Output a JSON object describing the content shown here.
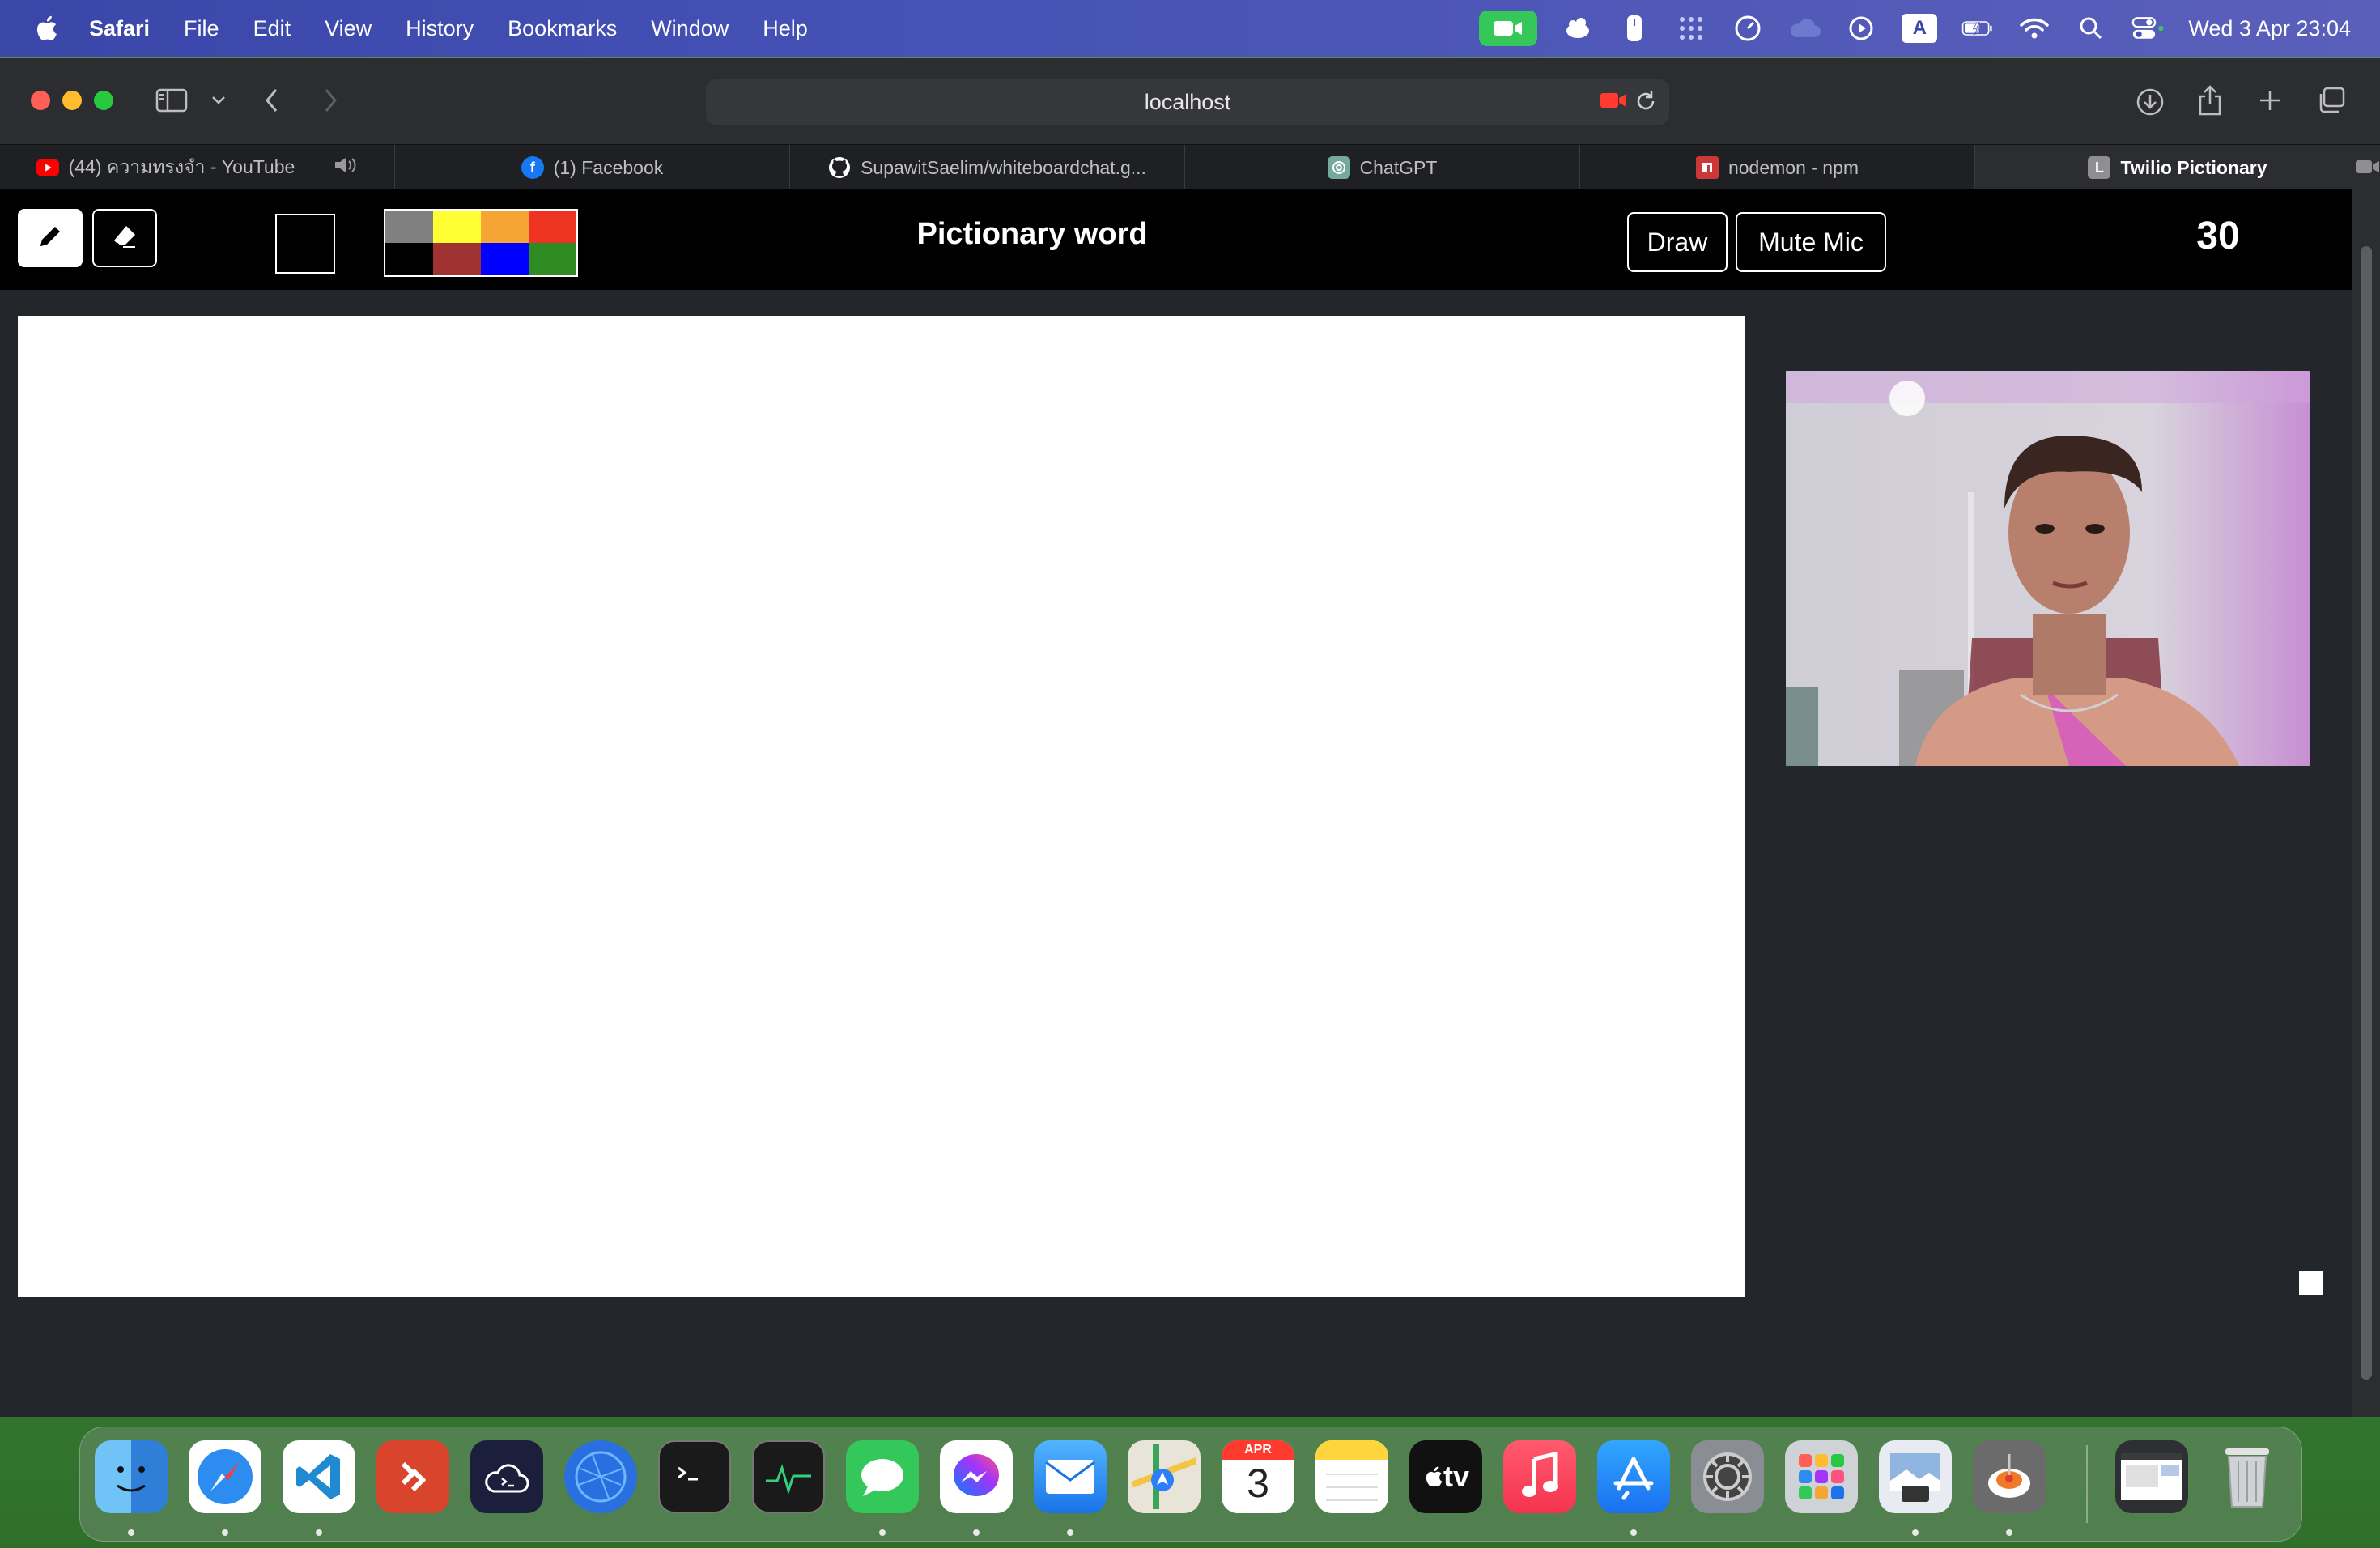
{
  "menubar": {
    "app_name": "Safari",
    "items": [
      "File",
      "Edit",
      "View",
      "History",
      "Bookmarks",
      "Window",
      "Help"
    ],
    "keyboard_indicator": "A",
    "clock": "Wed 3 Apr  23:04"
  },
  "browser": {
    "url": "localhost",
    "tabs": [
      {
        "title": "(44) ความทรงจำ - YouTube",
        "icon": "youtube-icon",
        "icon_color": "#ff0000"
      },
      {
        "title": "(1) Facebook",
        "icon": "facebook-icon",
        "icon_color": "#1877f2"
      },
      {
        "title": "SupawitSaelim/whiteboardchat.g...",
        "icon": "github-icon",
        "icon_color": "#ffffff"
      },
      {
        "title": "ChatGPT",
        "icon": "chatgpt-icon",
        "icon_color": "#74aa9c"
      },
      {
        "title": "nodemon - npm",
        "icon": "npm-icon",
        "icon_color": "#cb3837"
      },
      {
        "title": "Twilio Pictionary",
        "icon": "letter-l-icon",
        "icon_text": "L",
        "icon_color": "#8e8e93",
        "active": true
      }
    ]
  },
  "app": {
    "tools": [
      {
        "name": "pencil",
        "icon": "pencil-icon",
        "selected": true
      },
      {
        "name": "eraser",
        "icon": "eraser-icon",
        "selected": false
      }
    ],
    "current_color": "#000000",
    "palette": [
      "#808080",
      "#ffff33",
      "#f5a533",
      "#ee3322",
      "#000000",
      "#a03232",
      "#0000ff",
      "#2e8b22"
    ],
    "word": "Pictionary word",
    "draw_button": "Draw",
    "mute_button": "Mute Mic",
    "timer": "30"
  },
  "dock": {
    "apps": [
      "Finder",
      "Safari",
      "Visual Studio Code",
      "Remote Desktop",
      "Cloud Terminal",
      "Network Radar",
      "Terminal",
      "Activity Monitor",
      "Messages",
      "Messenger",
      "Mail",
      "Maps",
      "Calendar",
      "Notes",
      "TV",
      "Music",
      "App Store",
      "System Settings",
      "Launchpad",
      "Preview",
      "Pasta"
    ],
    "calendar_month": "APR",
    "calendar_day": "3",
    "tv_label": "tv"
  }
}
